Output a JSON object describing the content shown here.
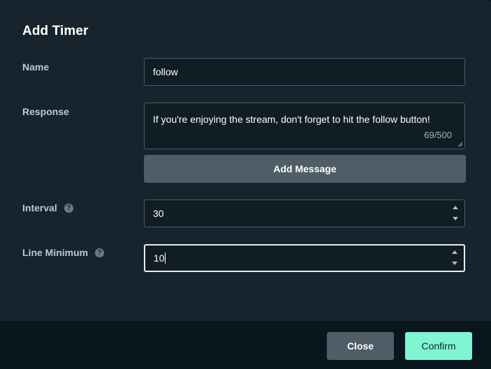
{
  "dialog": {
    "title": "Add Timer"
  },
  "form": {
    "name": {
      "label": "Name",
      "value": "follow"
    },
    "response": {
      "label": "Response",
      "value": "If you're enjoying the stream, don't forget to hit the follow button!",
      "counter": "69/500"
    },
    "add_message_label": "Add Message",
    "interval": {
      "label": "Interval",
      "value": "30",
      "help_icon": "?"
    },
    "line_minimum": {
      "label": "Line Minimum",
      "value": "10",
      "help_icon": "?"
    }
  },
  "footer": {
    "close_label": "Close",
    "confirm_label": "Confirm"
  },
  "colors": {
    "accent": "#80f5d2",
    "background": "#17242d",
    "footer": "#09161d"
  }
}
